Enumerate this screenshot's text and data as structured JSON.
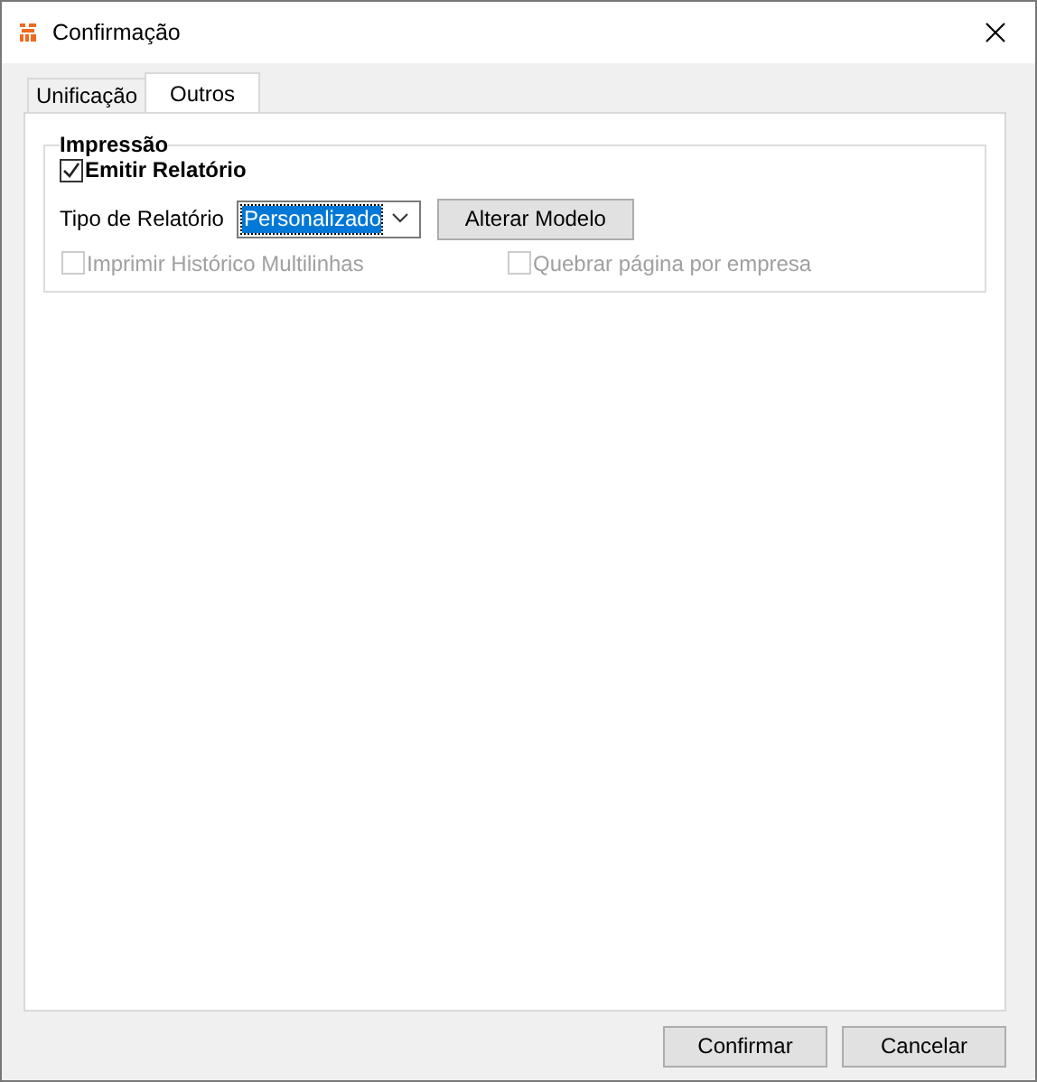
{
  "window": {
    "title": "Confirmação"
  },
  "tabs": [
    {
      "label": "Unificação",
      "selected": false
    },
    {
      "label": "Outros",
      "selected": true
    }
  ],
  "group": {
    "title": "Impressão",
    "emit": {
      "label": "Emitir Relatório",
      "checked": true,
      "disabled": false
    },
    "report_type": {
      "label": "Tipo de Relatório",
      "value": "Personalizado"
    },
    "alter_button": "Alterar Modelo",
    "options": [
      {
        "label": "Imprimir Histórico Multilinhas",
        "checked": false,
        "disabled": true
      },
      {
        "label": "Quebrar página por empresa",
        "checked": false,
        "disabled": true
      }
    ]
  },
  "buttons": [
    "Confirmar",
    "Cancelar"
  ]
}
